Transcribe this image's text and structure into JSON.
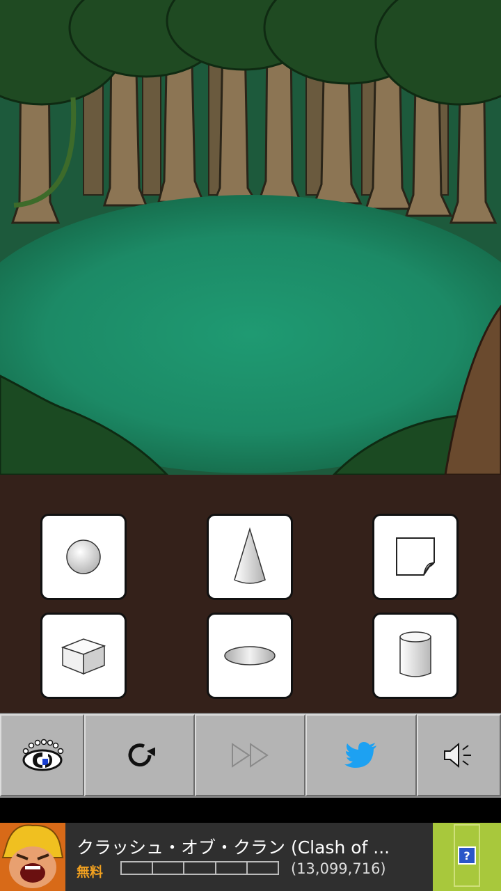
{
  "scene": {
    "name": "forest-clearing"
  },
  "items": [
    {
      "name": "sphere",
      "icon": "sphere-icon"
    },
    {
      "name": "cone",
      "icon": "cone-icon"
    },
    {
      "name": "paper",
      "icon": "paper-icon"
    },
    {
      "name": "cube",
      "icon": "cube-icon"
    },
    {
      "name": "disc",
      "icon": "disc-icon"
    },
    {
      "name": "cylinder",
      "icon": "cylinder-icon"
    }
  ],
  "toolbar": [
    {
      "name": "logo-button",
      "icon": "eye-logo-icon",
      "enabled": true
    },
    {
      "name": "restart-button",
      "icon": "restart-icon",
      "enabled": true
    },
    {
      "name": "skip-button",
      "icon": "fast-forward-icon",
      "enabled": false
    },
    {
      "name": "twitter-button",
      "icon": "twitter-bird-icon",
      "enabled": true
    },
    {
      "name": "sound-button",
      "icon": "speaker-icon",
      "enabled": true
    }
  ],
  "ad": {
    "title": "クラッシュ・オブ・クラン (Clash of ...",
    "price": "無料",
    "rating_count": "(13,099,716)",
    "info_label": "?",
    "accent_color": "#a8c83c"
  }
}
